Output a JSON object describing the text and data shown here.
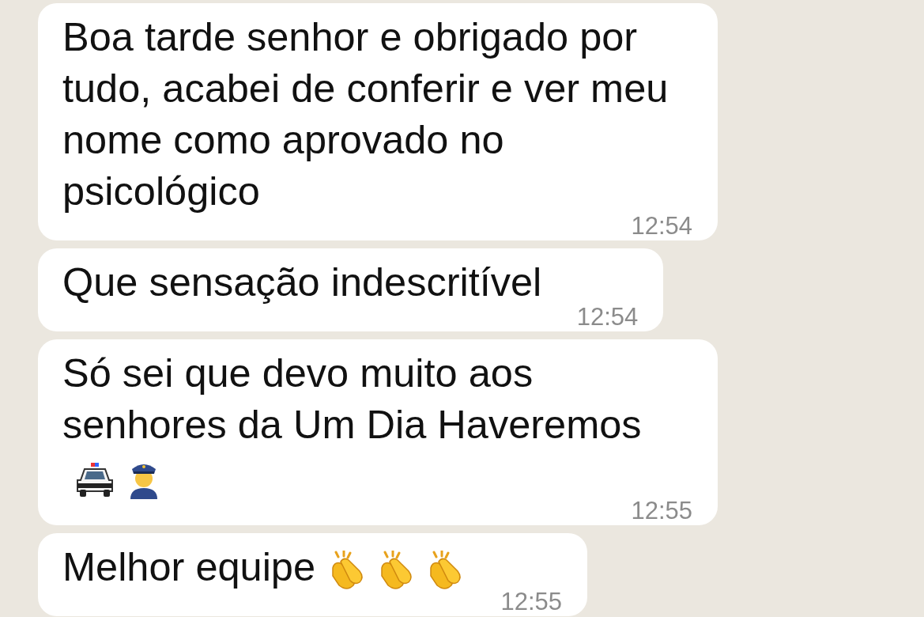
{
  "messages": [
    {
      "text": "Boa tarde senhor e obrigado por tudo, acabei de conferir e ver meu nome como aprovado no psicológico",
      "time": "12:54"
    },
    {
      "text": "Que sensação indescritível",
      "time": "12:54"
    },
    {
      "text": "Só sei que devo muito aos senhores da Um Dia Haveremos",
      "emoji": [
        {
          "kind": "police-car"
        },
        {
          "kind": "police-officer"
        }
      ],
      "time": "12:55"
    },
    {
      "text": "Melhor equipe",
      "emoji": [
        {
          "kind": "clap"
        },
        {
          "kind": "clap"
        },
        {
          "kind": "clap"
        }
      ],
      "time": "12:55"
    }
  ]
}
